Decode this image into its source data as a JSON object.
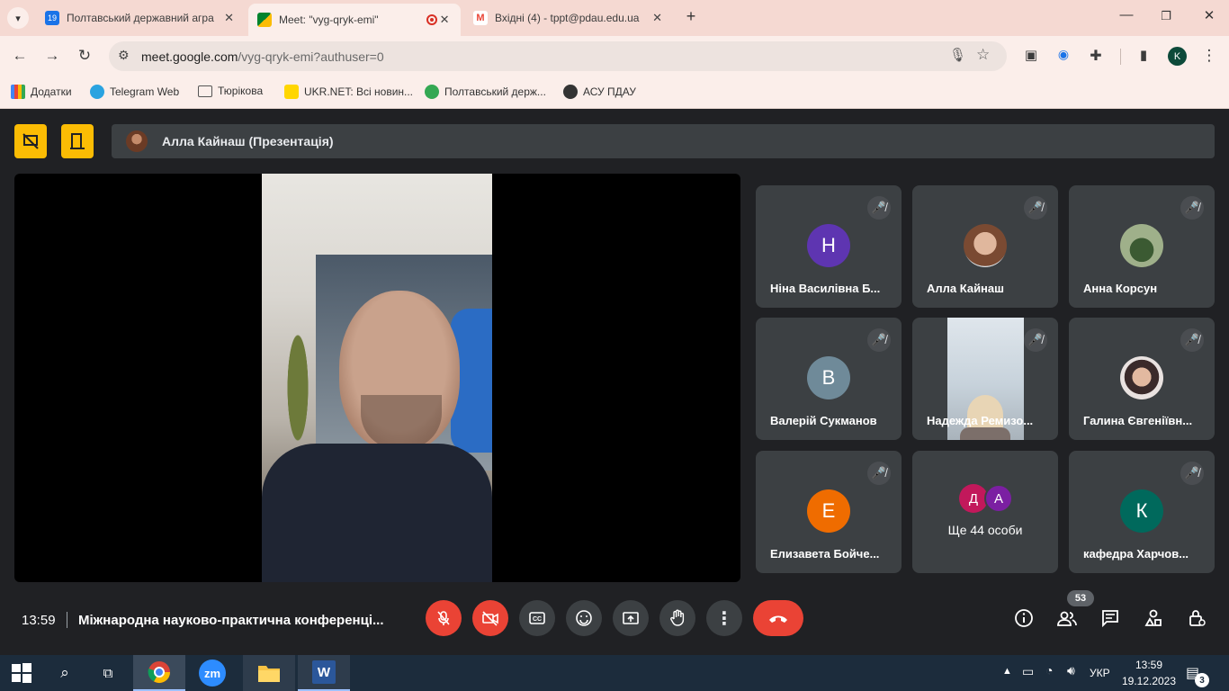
{
  "browser": {
    "tabs": [
      {
        "title": "Полтавський державний агра",
        "favicon_color": "#1a73e8",
        "favicon_text": "19"
      },
      {
        "title": "Meet: \"vyg-qryk-emi\"",
        "favicon_color": "#00832d",
        "recording": true
      },
      {
        "title": "Вхідні (4) - tppt@pdau.edu.ua",
        "favicon_color": "#ea4335",
        "favicon_text": "M"
      }
    ],
    "url_domain": "meet.google.com",
    "url_path": "/vyg-qryk-emi?authuser=0",
    "bookmarks": [
      {
        "label": "Додатки",
        "icon": "apps-grid-icon"
      },
      {
        "label": "Telegram Web",
        "icon": "telegram-icon"
      },
      {
        "label": "Тюрікова",
        "icon": "folder-icon"
      },
      {
        "label": "UKR.NET: Всі новин...",
        "icon": "ukrnet-icon"
      },
      {
        "label": "Полтавський держ...",
        "icon": "pdau-icon"
      },
      {
        "label": "АСУ ПДАУ",
        "icon": "globe-icon"
      }
    ],
    "profile_initial": "K"
  },
  "meet": {
    "presenter_name": "Алла Кайнаш (Презентація)",
    "participants": [
      {
        "name": "Ніна Василівна Б...",
        "initial": "Н",
        "color": "#5e35b1",
        "muted": true
      },
      {
        "name": "Алла Кайнаш",
        "initial": "",
        "color": "#8d6e63",
        "muted": true,
        "photo": true
      },
      {
        "name": "Анна Корсун",
        "initial": "",
        "color": "#4e6b3a",
        "muted": true,
        "photo": true
      },
      {
        "name": "Валерій Сукманов",
        "initial": "В",
        "color": "#6f8a99",
        "muted": true
      },
      {
        "name": "Надежда Ремизо...",
        "initial": "",
        "color": "#9aa7b3",
        "muted": true,
        "video": true
      },
      {
        "name": "Галина Євгеніївн...",
        "initial": "",
        "color": "#a1887f",
        "muted": true,
        "photo": true
      },
      {
        "name": "Елизавета Бойче...",
        "initial": "Е",
        "color": "#ef6c00",
        "muted": true
      },
      {
        "name": "Ще 44 особи",
        "initial": "",
        "more": true,
        "mini_initials": [
          "Д",
          "А"
        ],
        "mini_colors": [
          "#c2185b",
          "#7b1fa2"
        ]
      },
      {
        "name": "кафедра Харчов...",
        "initial": "К",
        "color": "#00695c",
        "muted": true
      }
    ],
    "time": "13:59",
    "meeting_title": "Міжнародна науково-практична конференці...",
    "participant_count": "53"
  },
  "taskbar": {
    "time": "13:59",
    "date": "19.12.2023",
    "lang": "УКР",
    "notifications": "3",
    "zoom_label": "zm"
  }
}
